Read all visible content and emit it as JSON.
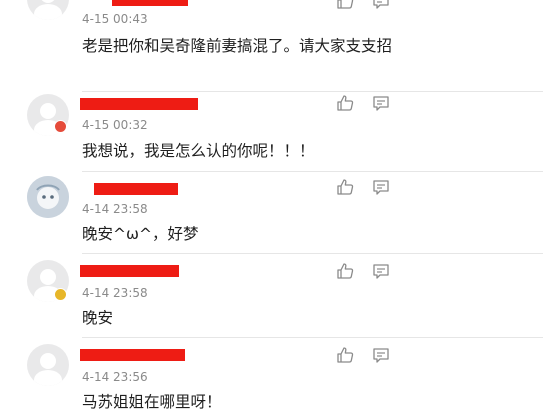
{
  "comments": [
    {
      "time": "4-15 00:43",
      "text": "老是把你和吴奇隆前妻搞混了。请大家支支招"
    },
    {
      "time": "4-15 00:32",
      "text": "我想说，我是怎么认的你呢！！！"
    },
    {
      "time": "4-14 23:58",
      "text": "晚安^ω^，好梦"
    },
    {
      "time": "4-14 23:58",
      "text": "晚安"
    },
    {
      "time": "4-14 23:56",
      "text": "马苏姐姐在哪里呀！"
    }
  ],
  "icons": {
    "like": "thumbs-up-icon",
    "reply": "comment-icon"
  },
  "colors": {
    "redaction": "#ee1c14",
    "meta_text": "#8a8a8a",
    "divider": "#e6e6e6"
  }
}
